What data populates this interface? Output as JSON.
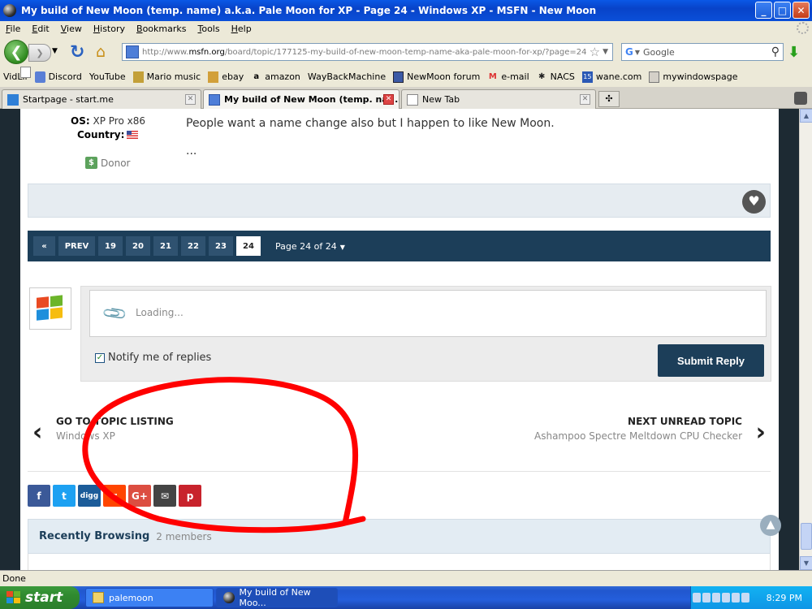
{
  "window": {
    "title": "My build of New Moon (temp. name) a.k.a. Pale Moon for XP - Page 24 - Windows XP - MSFN - New Moon",
    "buttons": {
      "minimize": "_",
      "maximize": "□",
      "close": "✕"
    }
  },
  "menu": [
    "File",
    "Edit",
    "View",
    "History",
    "Bookmarks",
    "Tools",
    "Help"
  ],
  "navbar": {
    "url_prefix": "http://www.",
    "url_domain": "msfn.org",
    "url_rest": "/board/topic/177125-my-build-of-new-moon-temp-name-aka-pale-moon-for-xp/?page=24",
    "search_engine": "G",
    "search_placeholder": "Google"
  },
  "bookmarks": [
    {
      "label": "VidLii",
      "icon": "page"
    },
    {
      "label": "Discord",
      "icon": "blue"
    },
    {
      "label": "YouTube",
      "icon": "page"
    },
    {
      "label": "Mario music",
      "icon": "mario"
    },
    {
      "label": "ebay",
      "icon": "ebay"
    },
    {
      "label": "amazon",
      "icon": "amz"
    },
    {
      "label": "WayBackMachine",
      "icon": "page"
    },
    {
      "label": "NewMoon forum",
      "icon": "moon"
    },
    {
      "label": "e-mail",
      "icon": "gmail"
    },
    {
      "label": "NACS",
      "icon": "nacs"
    },
    {
      "label": "wane.com",
      "icon": "wane"
    },
    {
      "label": "mywindowspage",
      "icon": "winpg"
    }
  ],
  "tabs": [
    {
      "label": "Startpage - start.me",
      "active": false
    },
    {
      "label": "My build of New Moon (temp. na...",
      "active": true
    },
    {
      "label": "New Tab",
      "active": false
    }
  ],
  "post": {
    "os_label": "OS:",
    "os_value": "XP Pro x86",
    "country_label": "Country:",
    "donor_label": "Donor",
    "text": "People want a name change also but I happen to like New Moon.",
    "ellipsis": "..."
  },
  "pagination": {
    "first": "«",
    "prev": "PREV",
    "pages": [
      "19",
      "20",
      "21",
      "22",
      "23",
      "24"
    ],
    "current": "24",
    "label": "Page 24 of 24"
  },
  "reply": {
    "placeholder": "Loading...",
    "notify_label": "Notify me of replies",
    "notify_checked": true,
    "submit_label": "Submit Reply"
  },
  "topic_nav": {
    "left_title": "GO TO TOPIC LISTING",
    "left_sub": "Windows XP",
    "right_title": "NEXT UNREAD TOPIC",
    "right_sub": "Ashampoo Spectre Meltdown CPU Checker"
  },
  "share_buttons": [
    {
      "name": "facebook",
      "glyph": "f",
      "color": "#3b5998"
    },
    {
      "name": "twitter",
      "glyph": "t",
      "color": "#1da1f2"
    },
    {
      "name": "digg",
      "glyph": "digg",
      "color": "#1c5c99"
    },
    {
      "name": "reddit",
      "glyph": "r",
      "color": "#ff4500"
    },
    {
      "name": "googleplus",
      "glyph": "G+",
      "color": "#dc4e41"
    },
    {
      "name": "email",
      "glyph": "✉",
      "color": "#444444"
    },
    {
      "name": "pinterest",
      "glyph": "p",
      "color": "#c8232c"
    }
  ],
  "recently_browsing": {
    "title": "Recently Browsing",
    "count": "2 members"
  },
  "status": "Done",
  "taskbar": {
    "start": "start",
    "tasks": [
      {
        "label": "palemoon",
        "active": false
      },
      {
        "label": "My build of New Moo...",
        "active": true
      }
    ],
    "clock": "8:29 PM"
  },
  "annotation_color": "#ff0000"
}
